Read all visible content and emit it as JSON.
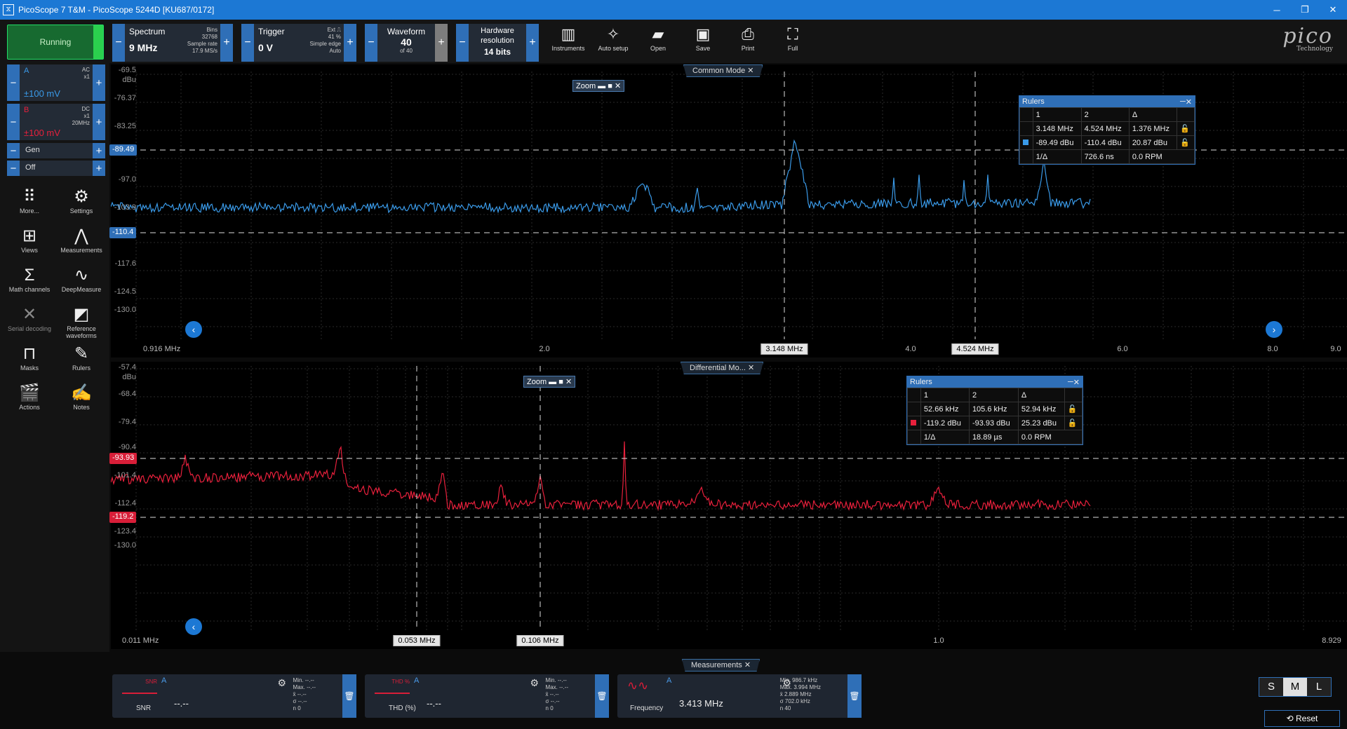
{
  "window": {
    "title": "PicoScope 7 T&M - PicoScope 5244D [KU687/0172]",
    "minimize": "─",
    "maximize": "❐",
    "close": "✕"
  },
  "toolbar": {
    "run_label": "Running",
    "spectrum": {
      "label": "Spectrum",
      "value": "9 MHz",
      "bins_label": "Bins",
      "bins": "32768",
      "sample_rate_label": "Sample rate",
      "sample_rate": "17.9 MS/s"
    },
    "trigger": {
      "label": "Trigger",
      "value": "0 V",
      "source": "Ext",
      "percent": "41 %",
      "type": "Simple edge",
      "mode": "Auto"
    },
    "waveform": {
      "label": "Waveform",
      "value": "40",
      "of": "of 40"
    },
    "resolution": {
      "label": "Hardware resolution",
      "value": "14 bits"
    },
    "buttons": [
      {
        "label": "Instruments",
        "icon": "instruments-icon"
      },
      {
        "label": "Auto setup",
        "icon": "auto-setup-icon"
      },
      {
        "label": "Open",
        "icon": "open-icon"
      },
      {
        "label": "Save",
        "icon": "save-icon"
      },
      {
        "label": "Print",
        "icon": "print-icon"
      },
      {
        "label": "Full",
        "icon": "full-screen-icon"
      }
    ],
    "logo": "pico",
    "logo_sub": "Technology"
  },
  "channels": {
    "a": {
      "name": "A",
      "coupling": "AC",
      "probe": "x1",
      "range": "±100 mV",
      "color": "#3a9ae8"
    },
    "b": {
      "name": "B",
      "coupling": "DC",
      "probe": "x1",
      "bw": "20MHz",
      "range": "±100 mV",
      "color": "#e8203c"
    },
    "gen": {
      "label": "Gen"
    },
    "off": {
      "label": "Off"
    }
  },
  "tools": [
    {
      "label": "More...",
      "icon": "grid-dots-icon"
    },
    {
      "label": "Settings",
      "icon": "gear-icon"
    },
    {
      "label": "Views",
      "icon": "views-icon"
    },
    {
      "label": "Measurements",
      "icon": "measurements-icon"
    },
    {
      "label": "Math channels",
      "icon": "sigma-icon"
    },
    {
      "label": "DeepMeasure",
      "icon": "deepmeasure-icon"
    },
    {
      "label": "Serial decoding",
      "icon": "serial-decoding-icon"
    },
    {
      "label": "Reference waveforms",
      "icon": "reference-waveforms-icon"
    },
    {
      "label": "Masks",
      "icon": "masks-icon"
    },
    {
      "label": "Rulers",
      "icon": "rulers-icon"
    },
    {
      "label": "Actions",
      "icon": "actions-icon"
    },
    {
      "label": "Notes",
      "icon": "notes-icon"
    }
  ],
  "view1": {
    "tab": "Common Mode",
    "y_unit": "dBu",
    "y_ticks": [
      "-69.5",
      "-76.37",
      "-83.25",
      "-97.0",
      "-103.9",
      "-117.6",
      "-124.5",
      "-130.0"
    ],
    "ruler_y": [
      "-89.49",
      "-110.4"
    ],
    "x_start": "0.916 MHz",
    "x_ticks": [
      "2.0",
      "4.0",
      "6.0",
      "8.0",
      "9.0"
    ],
    "ruler_x": [
      "3.148 MHz",
      "4.524 MHz"
    ],
    "zoom_label": "Zoom",
    "rulers": {
      "title": "Rulers",
      "h": [
        "1",
        "2",
        "Δ"
      ],
      "freq": [
        "3.148 MHz",
        "4.524 MHz",
        "1.376 MHz"
      ],
      "level": [
        "-89.49 dBu",
        "-110.4 dBu",
        "20.87 dBu"
      ],
      "inv_label": "1/Δ",
      "inv": "726.6 ns",
      "rpm": "0.0 RPM"
    }
  },
  "view2": {
    "tab": "Differential Mo...",
    "y_unit": "dBu",
    "y_ticks": [
      "-57.4",
      "-68.4",
      "-79.4",
      "-90.4",
      "-101.4",
      "-112.4",
      "-123.4",
      "-130.0"
    ],
    "ruler_y": [
      "-93.93",
      "-119.2"
    ],
    "x_start": "0.011 MHz",
    "x_ticks": [
      "1.0",
      "8.929"
    ],
    "ruler_x": [
      "0.053 MHz",
      "0.106 MHz"
    ],
    "zoom_label": "Zoom",
    "rulers": {
      "title": "Rulers",
      "h": [
        "1",
        "2",
        "Δ"
      ],
      "freq": [
        "52.66 kHz",
        "105.6 kHz",
        "52.94 kHz"
      ],
      "level": [
        "-119.2 dBu",
        "-93.93 dBu",
        "25.23 dBu"
      ],
      "inv_label": "1/Δ",
      "inv": "18.89 µs",
      "rpm": "0.0 RPM"
    }
  },
  "measurements": {
    "tab": "Measurements",
    "stat_labels": [
      "Min.",
      "Max.",
      "x̄",
      "σ",
      "n"
    ],
    "cards": [
      {
        "name": "SNR",
        "channel": "A",
        "value": "--.--",
        "stats": [
          "--.--",
          "--.--",
          "--.--",
          "--.--",
          "0"
        ],
        "thumb": "SNR"
      },
      {
        "name": "THD (%)",
        "channel": "A",
        "value": "--.--",
        "stats": [
          "--.--",
          "--.--",
          "--.--",
          "--.--",
          "0"
        ],
        "thumb": "THD %"
      },
      {
        "name": "Frequency",
        "channel": "A",
        "value": "3.413 MHz",
        "stats": [
          "986.7 kHz",
          "3.994 MHz",
          "2.889 MHz",
          "702.0 kHz",
          "40"
        ],
        "thumb": ""
      }
    ],
    "sizes": [
      "S",
      "M",
      "L"
    ],
    "selected_size": "M",
    "reset_label": "Reset"
  }
}
